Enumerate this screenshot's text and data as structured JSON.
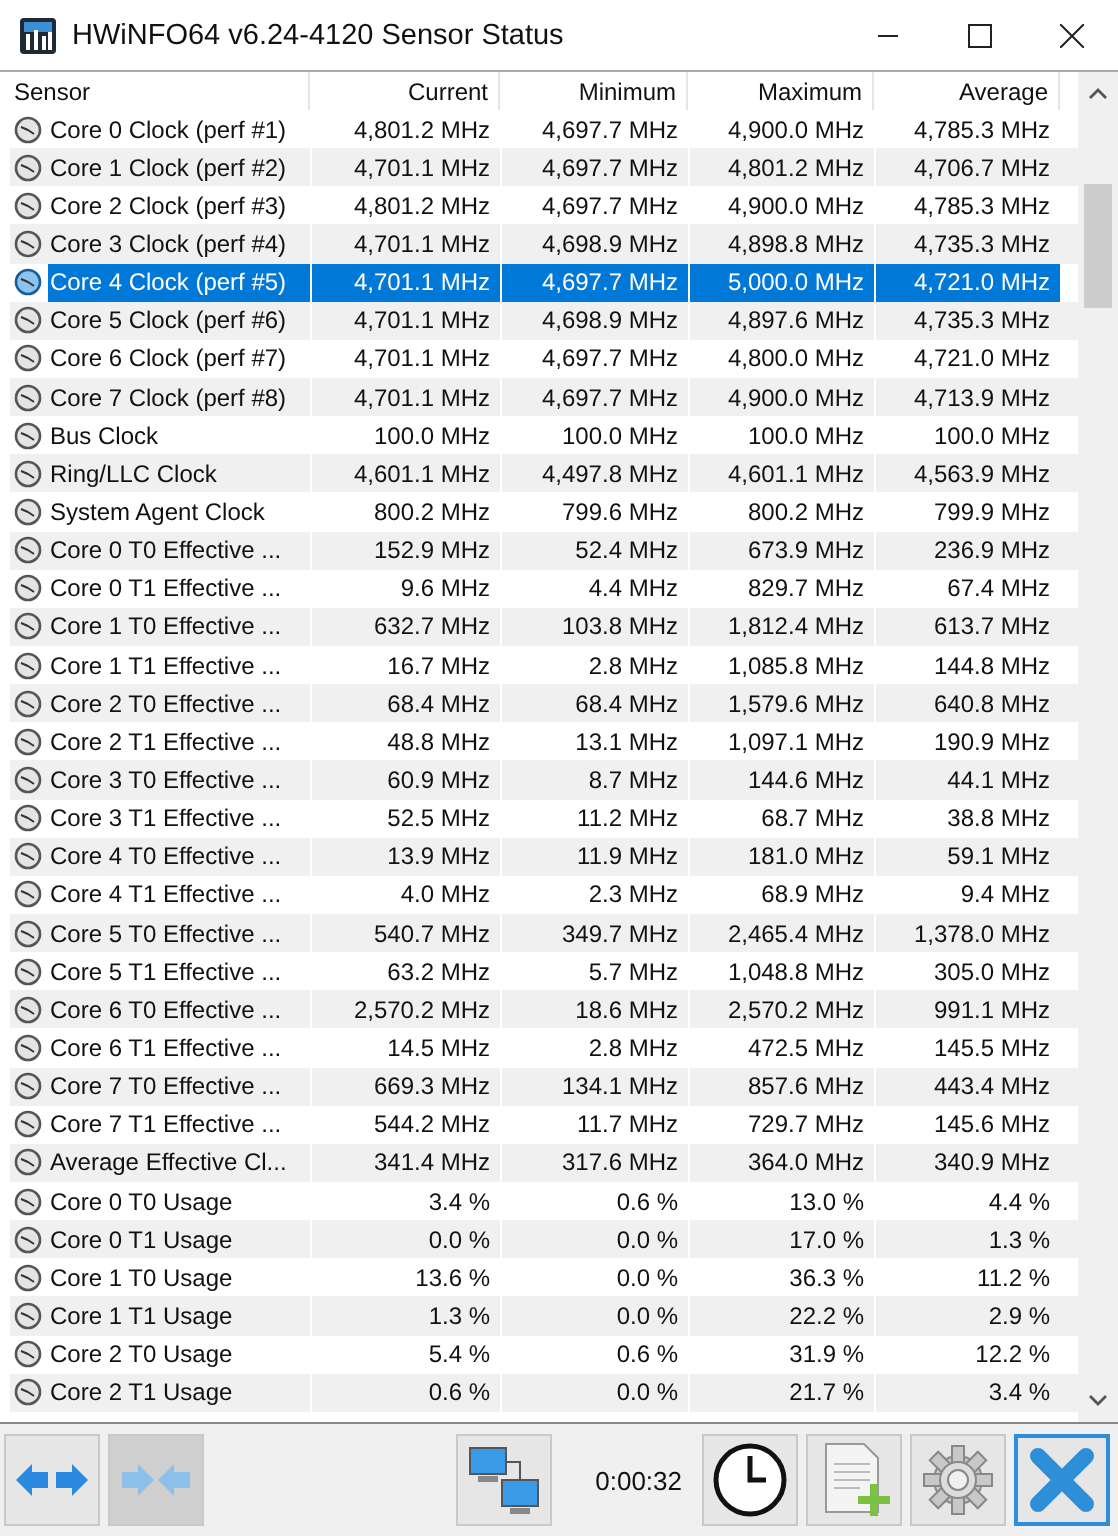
{
  "window": {
    "title": "HWiNFO64 v6.24-4120 Sensor Status"
  },
  "table": {
    "columns": [
      "Sensor",
      "Current",
      "Minimum",
      "Maximum",
      "Average"
    ],
    "rows": [
      {
        "sensor": "Core 0 Clock (perf #1)",
        "current": "4,801.2 MHz",
        "minimum": "4,697.7 MHz",
        "maximum": "4,900.0 MHz",
        "average": "4,785.3 MHz",
        "selected": false
      },
      {
        "sensor": "Core 1 Clock (perf #2)",
        "current": "4,701.1 MHz",
        "minimum": "4,697.7 MHz",
        "maximum": "4,801.2 MHz",
        "average": "4,706.7 MHz",
        "selected": false
      },
      {
        "sensor": "Core 2 Clock (perf #3)",
        "current": "4,801.2 MHz",
        "minimum": "4,697.7 MHz",
        "maximum": "4,900.0 MHz",
        "average": "4,785.3 MHz",
        "selected": false
      },
      {
        "sensor": "Core 3 Clock (perf #4)",
        "current": "4,701.1 MHz",
        "minimum": "4,698.9 MHz",
        "maximum": "4,898.8 MHz",
        "average": "4,735.3 MHz",
        "selected": false
      },
      {
        "sensor": "Core 4 Clock (perf #5)",
        "current": "4,701.1 MHz",
        "minimum": "4,697.7 MHz",
        "maximum": "5,000.0 MHz",
        "average": "4,721.0 MHz",
        "selected": true
      },
      {
        "sensor": "Core 5 Clock (perf #6)",
        "current": "4,701.1 MHz",
        "minimum": "4,698.9 MHz",
        "maximum": "4,897.6 MHz",
        "average": "4,735.3 MHz",
        "selected": false
      },
      {
        "sensor": "Core 6 Clock (perf #7)",
        "current": "4,701.1 MHz",
        "minimum": "4,697.7 MHz",
        "maximum": "4,800.0 MHz",
        "average": "4,721.0 MHz",
        "selected": false
      },
      {
        "sensor": "Core 7 Clock (perf #8)",
        "current": "4,701.1 MHz",
        "minimum": "4,697.7 MHz",
        "maximum": "4,900.0 MHz",
        "average": "4,713.9 MHz",
        "selected": false
      },
      {
        "sensor": "Bus Clock",
        "current": "100.0 MHz",
        "minimum": "100.0 MHz",
        "maximum": "100.0 MHz",
        "average": "100.0 MHz",
        "selected": false
      },
      {
        "sensor": "Ring/LLC Clock",
        "current": "4,601.1 MHz",
        "minimum": "4,497.8 MHz",
        "maximum": "4,601.1 MHz",
        "average": "4,563.9 MHz",
        "selected": false
      },
      {
        "sensor": "System Agent Clock",
        "current": "800.2 MHz",
        "minimum": "799.6 MHz",
        "maximum": "800.2 MHz",
        "average": "799.9 MHz",
        "selected": false
      },
      {
        "sensor": "Core 0 T0 Effective ...",
        "current": "152.9 MHz",
        "minimum": "52.4 MHz",
        "maximum": "673.9 MHz",
        "average": "236.9 MHz",
        "selected": false
      },
      {
        "sensor": "Core 0 T1 Effective ...",
        "current": "9.6 MHz",
        "minimum": "4.4 MHz",
        "maximum": "829.7 MHz",
        "average": "67.4 MHz",
        "selected": false
      },
      {
        "sensor": "Core 1 T0 Effective ...",
        "current": "632.7 MHz",
        "minimum": "103.8 MHz",
        "maximum": "1,812.4 MHz",
        "average": "613.7 MHz",
        "selected": false
      },
      {
        "sensor": "Core 1 T1 Effective ...",
        "current": "16.7 MHz",
        "minimum": "2.8 MHz",
        "maximum": "1,085.8 MHz",
        "average": "144.8 MHz",
        "selected": false
      },
      {
        "sensor": "Core 2 T0 Effective ...",
        "current": "68.4 MHz",
        "minimum": "68.4 MHz",
        "maximum": "1,579.6 MHz",
        "average": "640.8 MHz",
        "selected": false
      },
      {
        "sensor": "Core 2 T1 Effective ...",
        "current": "48.8 MHz",
        "minimum": "13.1 MHz",
        "maximum": "1,097.1 MHz",
        "average": "190.9 MHz",
        "selected": false
      },
      {
        "sensor": "Core 3 T0 Effective ...",
        "current": "60.9 MHz",
        "minimum": "8.7 MHz",
        "maximum": "144.6 MHz",
        "average": "44.1 MHz",
        "selected": false
      },
      {
        "sensor": "Core 3 T1 Effective ...",
        "current": "52.5 MHz",
        "minimum": "11.2 MHz",
        "maximum": "68.7 MHz",
        "average": "38.8 MHz",
        "selected": false
      },
      {
        "sensor": "Core 4 T0 Effective ...",
        "current": "13.9 MHz",
        "minimum": "11.9 MHz",
        "maximum": "181.0 MHz",
        "average": "59.1 MHz",
        "selected": false
      },
      {
        "sensor": "Core 4 T1 Effective ...",
        "current": "4.0 MHz",
        "minimum": "2.3 MHz",
        "maximum": "68.9 MHz",
        "average": "9.4 MHz",
        "selected": false
      },
      {
        "sensor": "Core 5 T0 Effective ...",
        "current": "540.7 MHz",
        "minimum": "349.7 MHz",
        "maximum": "2,465.4 MHz",
        "average": "1,378.0 MHz",
        "selected": false
      },
      {
        "sensor": "Core 5 T1 Effective ...",
        "current": "63.2 MHz",
        "minimum": "5.7 MHz",
        "maximum": "1,048.8 MHz",
        "average": "305.0 MHz",
        "selected": false
      },
      {
        "sensor": "Core 6 T0 Effective ...",
        "current": "2,570.2 MHz",
        "minimum": "18.6 MHz",
        "maximum": "2,570.2 MHz",
        "average": "991.1 MHz",
        "selected": false
      },
      {
        "sensor": "Core 6 T1 Effective ...",
        "current": "14.5 MHz",
        "minimum": "2.8 MHz",
        "maximum": "472.5 MHz",
        "average": "145.5 MHz",
        "selected": false
      },
      {
        "sensor": "Core 7 T0 Effective ...",
        "current": "669.3 MHz",
        "minimum": "134.1 MHz",
        "maximum": "857.6 MHz",
        "average": "443.4 MHz",
        "selected": false
      },
      {
        "sensor": "Core 7 T1 Effective ...",
        "current": "544.2 MHz",
        "minimum": "11.7 MHz",
        "maximum": "729.7 MHz",
        "average": "145.6 MHz",
        "selected": false
      },
      {
        "sensor": "Average Effective Cl...",
        "current": "341.4 MHz",
        "minimum": "317.6 MHz",
        "maximum": "364.0 MHz",
        "average": "340.9 MHz",
        "selected": false
      },
      {
        "sensor": "Core 0 T0 Usage",
        "current": "3.4 %",
        "minimum": "0.6 %",
        "maximum": "13.0 %",
        "average": "4.4 %",
        "selected": false
      },
      {
        "sensor": "Core 0 T1 Usage",
        "current": "0.0 %",
        "minimum": "0.0 %",
        "maximum": "17.0 %",
        "average": "1.3 %",
        "selected": false
      },
      {
        "sensor": "Core 1 T0 Usage",
        "current": "13.6 %",
        "minimum": "0.0 %",
        "maximum": "36.3 %",
        "average": "11.2 %",
        "selected": false
      },
      {
        "sensor": "Core 1 T1 Usage",
        "current": "1.3 %",
        "minimum": "0.0 %",
        "maximum": "22.2 %",
        "average": "2.9 %",
        "selected": false
      },
      {
        "sensor": "Core 2 T0 Usage",
        "current": "5.4 %",
        "minimum": "0.6 %",
        "maximum": "31.9 %",
        "average": "12.2 %",
        "selected": false
      },
      {
        "sensor": "Core 2 T1 Usage",
        "current": "0.6 %",
        "minimum": "0.0 %",
        "maximum": "21.7 %",
        "average": "3.4 %",
        "selected": false
      }
    ]
  },
  "toolbar": {
    "timer": "0:00:32"
  }
}
